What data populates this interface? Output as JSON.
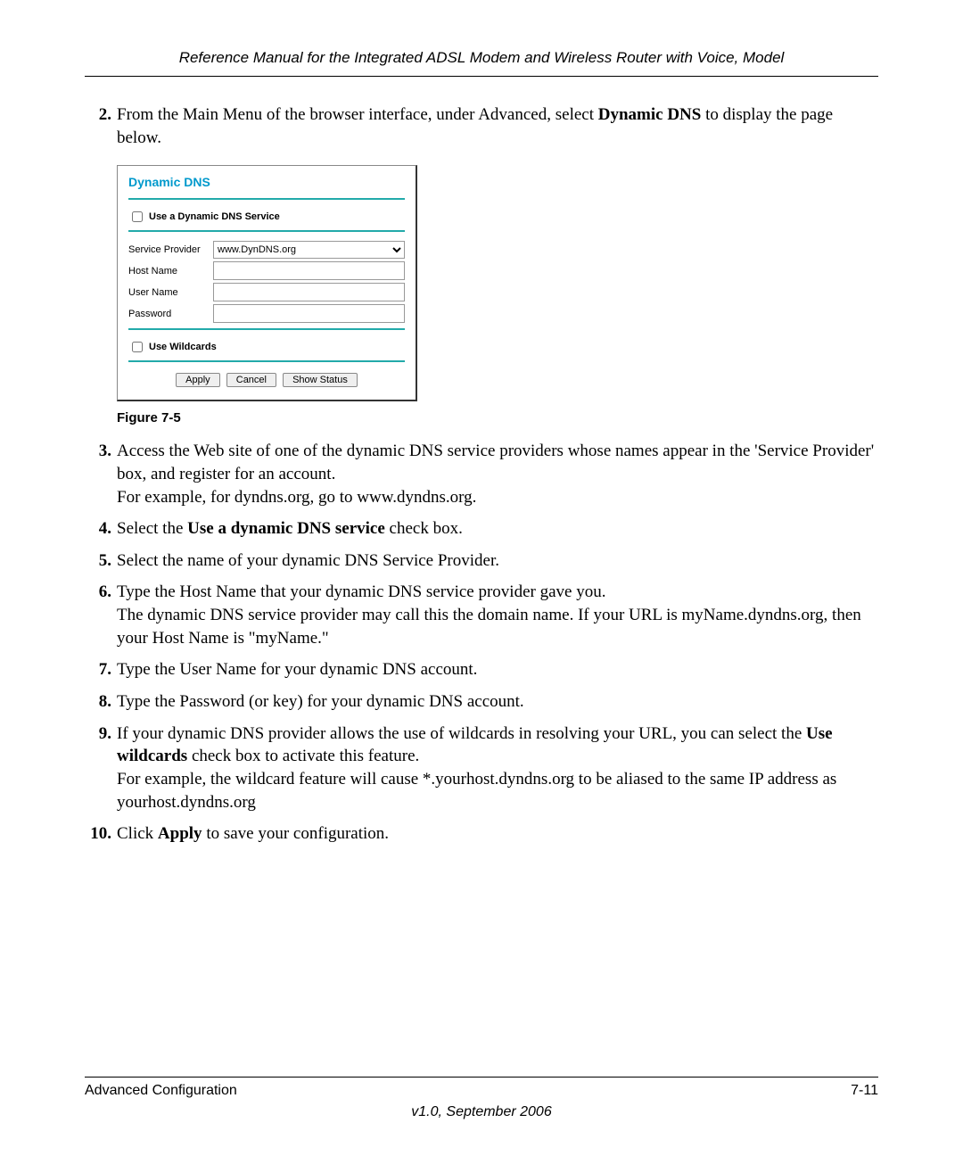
{
  "header": "Reference Manual for the Integrated ADSL Modem and Wireless Router with Voice, Model",
  "steps": {
    "s2": {
      "num": "2.",
      "pre": "From the Main Menu of the browser interface, under Advanced, select ",
      "bold": "Dynamic DNS",
      "post": " to display the page below."
    },
    "s3": {
      "num": "3.",
      "text": "Access the Web site of one of the dynamic DNS service providers whose names appear in the 'Service Provider' box, and register for an account.",
      "line2": "For example, for dyndns.org, go to www.dyndns.org."
    },
    "s4": {
      "num": "4.",
      "pre": "Select the ",
      "bold": "Use a dynamic DNS service",
      "post": " check box."
    },
    "s5": {
      "num": "5.",
      "text": "Select the name of your dynamic DNS Service Provider."
    },
    "s6": {
      "num": "6.",
      "text": "Type the Host Name that your dynamic DNS service provider gave you.",
      "line2": "The dynamic DNS service provider may call this the domain name. If your URL is myName.dyndns.org, then your Host Name is \"myName.\""
    },
    "s7": {
      "num": "7.",
      "text": "Type the User Name for your dynamic DNS account."
    },
    "s8": {
      "num": "8.",
      "text": "Type the Password (or key) for your dynamic DNS account."
    },
    "s9": {
      "num": "9.",
      "pre": "If your dynamic DNS provider allows the use of wildcards in resolving your URL, you can select the ",
      "bold": "Use wildcards",
      "post": " check box to activate this feature.",
      "line2": "For example, the wildcard feature will cause *.yourhost.dyndns.org to be aliased to the same IP address as yourhost.dyndns.org"
    },
    "s10": {
      "num": "10.",
      "pre": "Click ",
      "bold": "Apply",
      "post": " to save your configuration."
    }
  },
  "figure": {
    "caption": "Figure 7-5",
    "title": "Dynamic DNS",
    "use_service_label": "Use a Dynamic DNS Service",
    "provider_label": "Service Provider",
    "provider_value": "www.DynDNS.org",
    "host_label": "Host Name",
    "user_label": "User Name",
    "pass_label": "Password",
    "wildcards_label": "Use Wildcards",
    "apply": "Apply",
    "cancel": "Cancel",
    "show_status": "Show Status"
  },
  "footer": {
    "left": "Advanced Configuration",
    "right": "7-11",
    "version": "v1.0, September 2006"
  }
}
